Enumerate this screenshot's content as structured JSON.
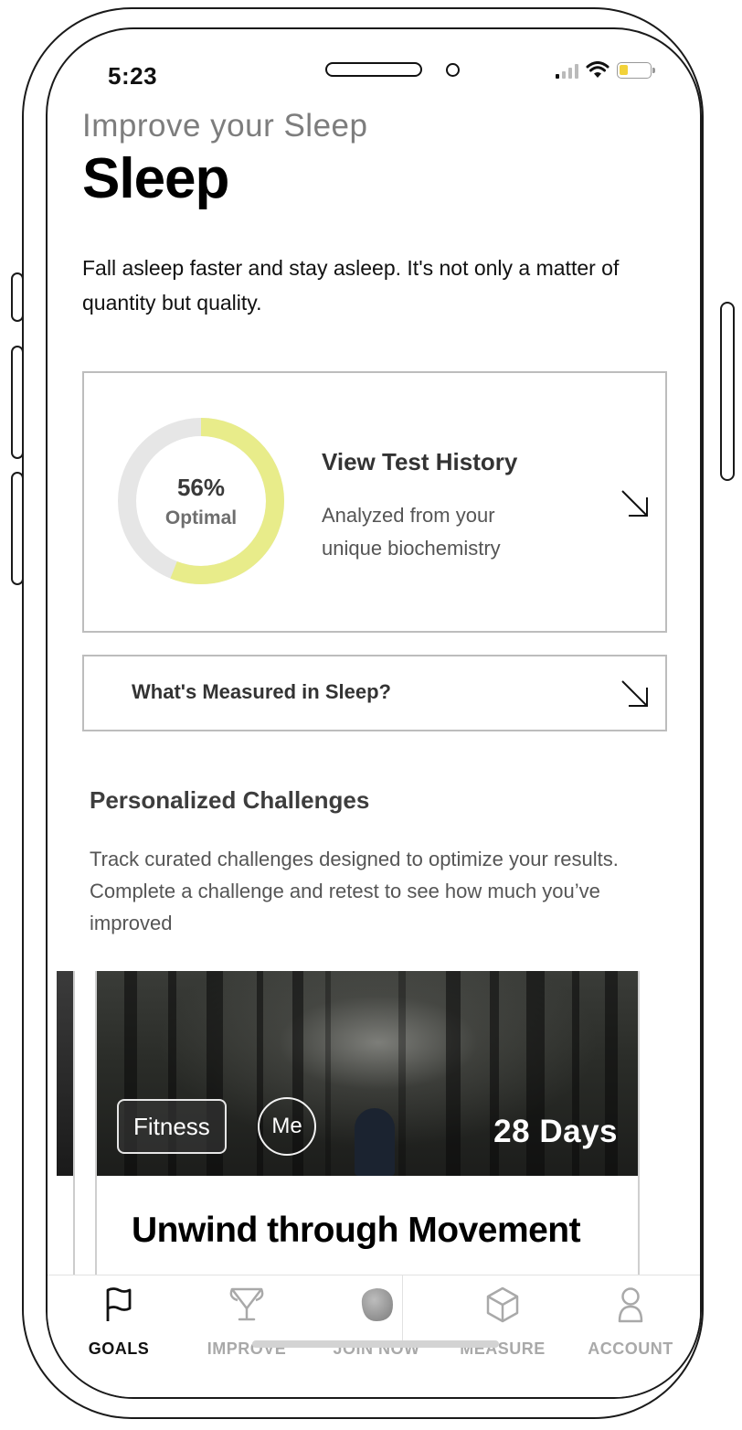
{
  "status_bar": {
    "time": "5:23"
  },
  "header": {
    "eyebrow": "Improve your Sleep",
    "title": "Sleep",
    "intro": "Fall asleep faster and stay asleep. It's not only a matter of quantity but quality."
  },
  "score_card": {
    "percent_text": "56%",
    "percent_value": 56,
    "status": "Optimal",
    "title": "View Test History",
    "subtitle": "Analyzed from your unique biochemistry",
    "ring_color": "#e8ec8a",
    "ring_track_color": "#e6e6e6"
  },
  "measured": {
    "label": "What's Measured in Sleep?"
  },
  "challenges": {
    "title": "Personalized Challenges",
    "description": "Track curated challenges designed to optimize your results. Complete a challenge and retest to see how much you’ve improved",
    "card": {
      "tag": "Fitness",
      "badge": "Me",
      "duration": "28 Days",
      "title": "Unwind through Movement"
    }
  },
  "nav": {
    "items": [
      {
        "label": "GOALS",
        "icon": "flag-icon",
        "active": true
      },
      {
        "label": "IMPROVE",
        "icon": "trophy-icon",
        "active": false
      },
      {
        "label": "JOIN NOW",
        "icon": "blob-icon",
        "active": false
      },
      {
        "label": "MEASURE",
        "icon": "cube-icon",
        "active": false
      },
      {
        "label": "ACCOUNT",
        "icon": "user-icon",
        "active": false
      }
    ]
  }
}
